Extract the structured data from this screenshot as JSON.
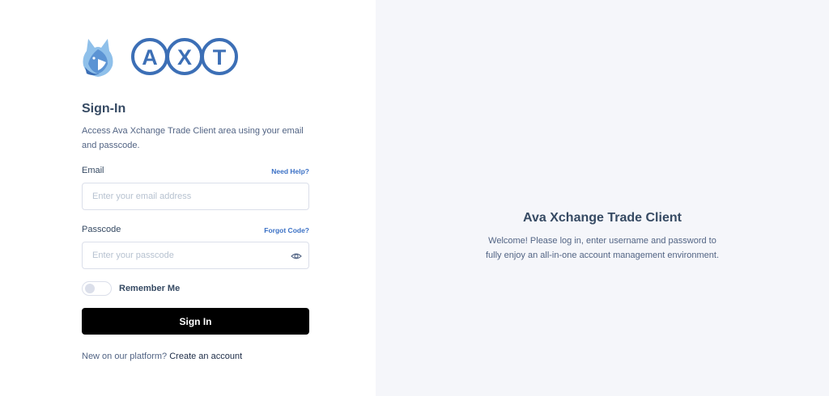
{
  "brand": {
    "logo_text": "AXT",
    "brand_color": "#3c6fb6",
    "accent_color": "#7ab3e6"
  },
  "signin": {
    "title": "Sign-In",
    "description": "Access Ava Xchange Trade Client area using your email and passcode.",
    "email_label": "Email",
    "need_help": "Need Help?",
    "email_placeholder": "Enter your email address",
    "email_value": "",
    "passcode_label": "Passcode",
    "forgot_code": "Forgot Code?",
    "passcode_placeholder": "Enter your passcode",
    "passcode_value": "",
    "remember_label": "Remember Me",
    "remember_checked": false,
    "button_label": "Sign In",
    "register_prompt": "New on our platform?",
    "register_link": "Create an account"
  },
  "promo": {
    "title": "Ava Xchange Trade Client",
    "text": "Welcome! Please log in, enter username and password to fully enjoy an all-in-one account management environment."
  },
  "icons": {
    "eye": "eye-icon",
    "fox": "fox-logo-icon"
  }
}
